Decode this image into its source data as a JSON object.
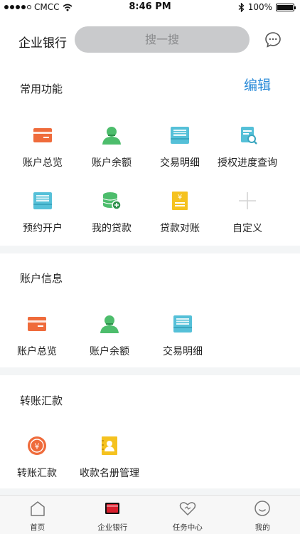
{
  "status_bar": {
    "carrier": "CMCC",
    "time": "8:46 PM",
    "battery": "100%"
  },
  "header": {
    "title": "企业银行",
    "search_placeholder": "搜一搜"
  },
  "common": {
    "title": "常用功能",
    "edit": "编辑",
    "items": [
      {
        "label": "账户总览",
        "icon": "card-icon"
      },
      {
        "label": "账户余额",
        "icon": "person-icon"
      },
      {
        "label": "交易明细",
        "icon": "document-icon"
      },
      {
        "label": "授权进度查询",
        "icon": "search-document-icon"
      },
      {
        "label": "预约开户",
        "icon": "document-icon"
      },
      {
        "label": "我的贷款",
        "icon": "coins-icon"
      },
      {
        "label": "贷款对账",
        "icon": "yuan-bill-icon"
      },
      {
        "label": "自定义",
        "icon": "plus-icon"
      }
    ]
  },
  "account_info": {
    "title": "账户信息",
    "items": [
      {
        "label": "账户总览",
        "icon": "card-icon"
      },
      {
        "label": "账户余额",
        "icon": "person-icon"
      },
      {
        "label": "交易明细",
        "icon": "document-icon"
      }
    ]
  },
  "transfer": {
    "title": "转账汇款",
    "items": [
      {
        "label": "转账汇款",
        "icon": "transfer-icon"
      },
      {
        "label": "收款名册管理",
        "icon": "payee-book-icon"
      }
    ]
  },
  "tabbar": {
    "items": [
      {
        "label": "首页",
        "icon": "home-icon"
      },
      {
        "label": "企业银行",
        "icon": "bank-card-icon"
      },
      {
        "label": "任务中心",
        "icon": "heart-icon"
      },
      {
        "label": "我的",
        "icon": "smile-icon"
      }
    ]
  },
  "colors": {
    "accent": "#2b8bd8",
    "orange": "#ef6b3b",
    "green": "#4dbd6c",
    "teal": "#55c0d8",
    "yellow": "#f5c21f"
  }
}
